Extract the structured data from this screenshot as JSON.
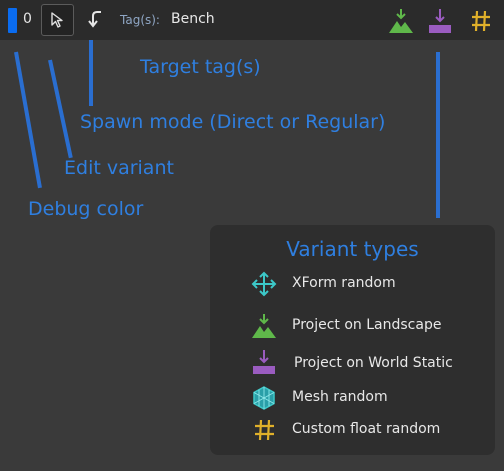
{
  "toolbar": {
    "debug_index": "0",
    "tags_label": "Tag(s):",
    "tags_value": "Bench"
  },
  "callouts": {
    "target_tags": "Target tag(s)",
    "spawn_mode": "Spawn mode (Direct or Regular)",
    "edit_variant": "Edit variant",
    "debug_color": "Debug color"
  },
  "legend": {
    "title": "Variant types",
    "items": [
      {
        "label": "XForm random",
        "icon": "xform-icon"
      },
      {
        "label": "Project on Landscape",
        "icon": "landscape-icon"
      },
      {
        "label": "Project on World Static",
        "icon": "world-static-icon"
      },
      {
        "label": "Mesh random",
        "icon": "mesh-icon"
      },
      {
        "label": "Custom float random",
        "icon": "hash-icon"
      }
    ]
  },
  "colors": {
    "accent_blue": "#2f7fe0",
    "debug_color": "#0a6cf0",
    "landscape_green": "#5fb84a",
    "world_static_purple": "#9a5cc0",
    "xform_cyan": "#3cc8c8",
    "hash_yellow": "#e0b02a"
  }
}
